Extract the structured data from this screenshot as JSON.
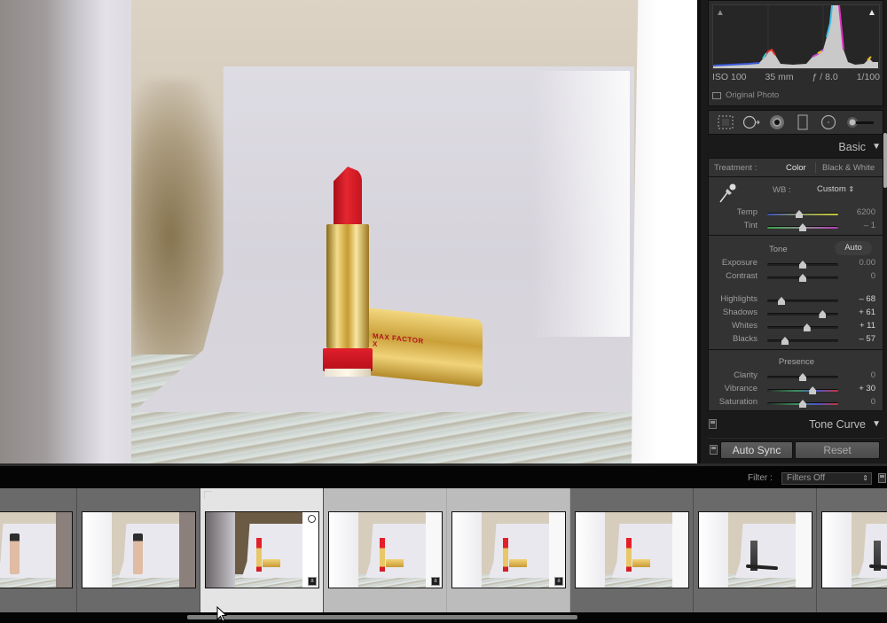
{
  "app": "Lightroom Develop module",
  "photo": {
    "subject": "lipstick on white paper backdrop",
    "brand_text": "MAX FACTOR X"
  },
  "histogram": {
    "iso": "ISO 100",
    "focal_length": "35 mm",
    "aperture": "ƒ / 8.0",
    "shutter": "1/100",
    "original_photo_label": "Original Photo"
  },
  "tools": [
    "crop-overlay-icon",
    "spot-removal-icon",
    "red-eye-icon",
    "graduated-filter-icon",
    "radial-filter-icon",
    "adjustment-brush-icon"
  ],
  "basic": {
    "header": "Basic",
    "treatment_label": "Treatment :",
    "treatment_options": [
      "Color",
      "Black & White"
    ],
    "treatment_selected": "Color",
    "wb_label": "WB :",
    "wb_value": "Custom",
    "wb_sliders": [
      {
        "label": "Temp",
        "value": "6200",
        "position": 0.45
      },
      {
        "label": "Tint",
        "value": "– 1",
        "position": 0.5
      }
    ],
    "tone_label": "Tone",
    "auto_label": "Auto",
    "tone_sliders": [
      {
        "label": "Exposure",
        "value": "0.00",
        "position": 0.5
      },
      {
        "label": "Contrast",
        "value": "0",
        "position": 0.5
      }
    ],
    "light_sliders": [
      {
        "label": "Highlights",
        "value": "– 68",
        "position": 0.2
      },
      {
        "label": "Shadows",
        "value": "+ 61",
        "position": 0.78
      },
      {
        "label": "Whites",
        "value": "+ 11",
        "position": 0.56
      },
      {
        "label": "Blacks",
        "value": "– 57",
        "position": 0.25
      }
    ],
    "presence_label": "Presence",
    "presence_sliders": [
      {
        "label": "Clarity",
        "value": "0",
        "position": 0.5
      },
      {
        "label": "Vibrance",
        "value": "+ 30",
        "position": 0.64
      },
      {
        "label": "Saturation",
        "value": "0",
        "position": 0.5
      }
    ]
  },
  "tone_curve": {
    "header": "Tone Curve"
  },
  "buttons": {
    "auto_sync": "Auto Sync",
    "reset": "Reset"
  },
  "filmstrip": {
    "filter_label": "Filter :",
    "filter_value": "Filters Off",
    "thumbnails": [
      {
        "subject": "foundation",
        "state": "normal",
        "edited": false
      },
      {
        "subject": "foundation",
        "state": "normal",
        "edited": false
      },
      {
        "subject": "lipstick",
        "state": "selected",
        "edited": true
      },
      {
        "subject": "lipstick",
        "state": "active",
        "edited": true
      },
      {
        "subject": "lipstick",
        "state": "active",
        "edited": true
      },
      {
        "subject": "lipstick",
        "state": "normal",
        "edited": false
      },
      {
        "subject": "mascara",
        "state": "normal",
        "edited": false
      },
      {
        "subject": "mascara",
        "state": "normal",
        "edited": false
      }
    ],
    "scroll_position": 0.3
  }
}
